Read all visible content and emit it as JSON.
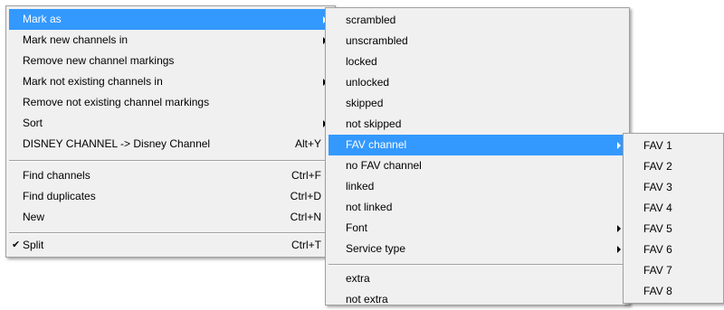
{
  "main_menu": {
    "items": [
      {
        "label": "Mark as",
        "shortcut": "",
        "submenu": true,
        "highlighted": true
      },
      {
        "label": "Mark new channels in",
        "shortcut": "",
        "submenu": true
      },
      {
        "label": "Remove new channel markings",
        "shortcut": "",
        "submenu": false
      },
      {
        "label": "Mark not existing channels in",
        "shortcut": "",
        "submenu": true
      },
      {
        "label": "Remove not existing channel markings",
        "shortcut": "",
        "submenu": false
      },
      {
        "label": "Sort",
        "shortcut": "",
        "submenu": true
      },
      {
        "label": "DISNEY CHANNEL -> Disney Channel",
        "shortcut": "Alt+Y",
        "submenu": false
      },
      {
        "label": "Find channels",
        "shortcut": "Ctrl+F",
        "submenu": false
      },
      {
        "label": "Find duplicates",
        "shortcut": "Ctrl+D",
        "submenu": false
      },
      {
        "label": "New",
        "shortcut": "Ctrl+N",
        "submenu": false
      },
      {
        "label": "Split",
        "shortcut": "Ctrl+T",
        "submenu": false,
        "checked": true
      }
    ],
    "check_glyph": "✔"
  },
  "mark_as_submenu": {
    "items": [
      {
        "label": "scrambled"
      },
      {
        "label": "unscrambled"
      },
      {
        "label": "locked"
      },
      {
        "label": "unlocked"
      },
      {
        "label": "skipped"
      },
      {
        "label": "not skipped"
      },
      {
        "label": "FAV channel",
        "submenu": true,
        "highlighted": true
      },
      {
        "label": "no FAV channel"
      },
      {
        "label": "linked"
      },
      {
        "label": "not linked"
      },
      {
        "label": "Font",
        "submenu": true
      },
      {
        "label": "Service type",
        "submenu": true
      },
      {
        "label": "extra"
      },
      {
        "label": "not extra"
      }
    ]
  },
  "fav_submenu": {
    "items": [
      {
        "label": "FAV 1"
      },
      {
        "label": "FAV 2"
      },
      {
        "label": "FAV 3"
      },
      {
        "label": "FAV 4"
      },
      {
        "label": "FAV 5"
      },
      {
        "label": "FAV 6"
      },
      {
        "label": "FAV 7"
      },
      {
        "label": "FAV 8"
      }
    ]
  },
  "colors": {
    "menu_background": "#f0f0f0",
    "highlight": "#3399ff",
    "highlight_text": "#ffffff",
    "border": "#a0a0a0"
  }
}
